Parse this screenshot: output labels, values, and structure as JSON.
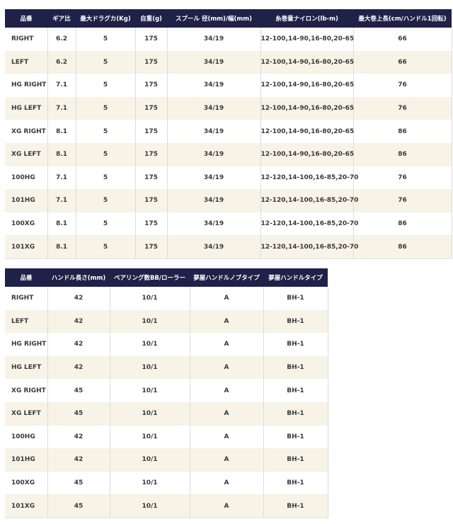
{
  "colors": {
    "header_bg": "#1f2148",
    "header_text": "#ffffff",
    "stripe_bg": "#f7f3e6",
    "row_bg": "#ffffff"
  },
  "table1": {
    "headers": [
      "品番",
      "ギア比",
      "最大ドラグカ(Kg)",
      "自重(g)",
      "スプール 径(mm)/幅(mm)",
      "糸巻量ナイロン(lb-m)",
      "最大巻上長(cm/ハンドル1回転)"
    ],
    "rows": [
      [
        "RIGHT",
        "6.2",
        "5",
        "175",
        "34/19",
        "12-100,14-90,16-80,20-65",
        "66"
      ],
      [
        "LEFT",
        "6.2",
        "5",
        "175",
        "34/19",
        "12-100,14-90,16-80,20-65",
        "66"
      ],
      [
        "HG RIGHT",
        "7.1",
        "5",
        "175",
        "34/19",
        "12-100,14-90,16-80,20-65",
        "76"
      ],
      [
        "HG LEFT",
        "7.1",
        "5",
        "175",
        "34/19",
        "12-100,14-90,16-80,20-65",
        "76"
      ],
      [
        "XG RIGHT",
        "8.1",
        "5",
        "175",
        "34/19",
        "12-100,14-90,16-80,20-65",
        "86"
      ],
      [
        "XG LEFT",
        "8.1",
        "5",
        "175",
        "34/19",
        "12-100,14-90,16-80,20-65",
        "86"
      ],
      [
        "100HG",
        "7.1",
        "5",
        "175",
        "34/19",
        "12-120,14-100,16-85,20-70",
        "76"
      ],
      [
        "101HG",
        "7.1",
        "5",
        "175",
        "34/19",
        "12-120,14-100,16-85,20-70",
        "76"
      ],
      [
        "100XG",
        "8.1",
        "5",
        "175",
        "34/19",
        "12-120,14-100,16-85,20-70",
        "86"
      ],
      [
        "101XG",
        "8.1",
        "5",
        "175",
        "34/19",
        "12-120,14-100,16-85,20-70",
        "86"
      ]
    ]
  },
  "table2": {
    "headers": [
      "品番",
      "ハンドル長さ(mm)",
      "ベアリング数BB/ローラー",
      "夢屋ハンドルノブタイプ",
      "夢屋ハンドルタイプ"
    ],
    "rows": [
      [
        "RIGHT",
        "42",
        "10/1",
        "A",
        "BH-1"
      ],
      [
        "LEFT",
        "42",
        "10/1",
        "A",
        "BH-1"
      ],
      [
        "HG RIGHT",
        "42",
        "10/1",
        "A",
        "BH-1"
      ],
      [
        "HG LEFT",
        "42",
        "10/1",
        "A",
        "BH-1"
      ],
      [
        "XG RIGHT",
        "45",
        "10/1",
        "A",
        "BH-1"
      ],
      [
        "XG LEFT",
        "45",
        "10/1",
        "A",
        "BH-1"
      ],
      [
        "100HG",
        "42",
        "10/1",
        "A",
        "BH-1"
      ],
      [
        "101HG",
        "42",
        "10/1",
        "A",
        "BH-1"
      ],
      [
        "100XG",
        "45",
        "10/1",
        "A",
        "BH-1"
      ],
      [
        "101XG",
        "45",
        "10/1",
        "A",
        "BH-1"
      ]
    ]
  }
}
